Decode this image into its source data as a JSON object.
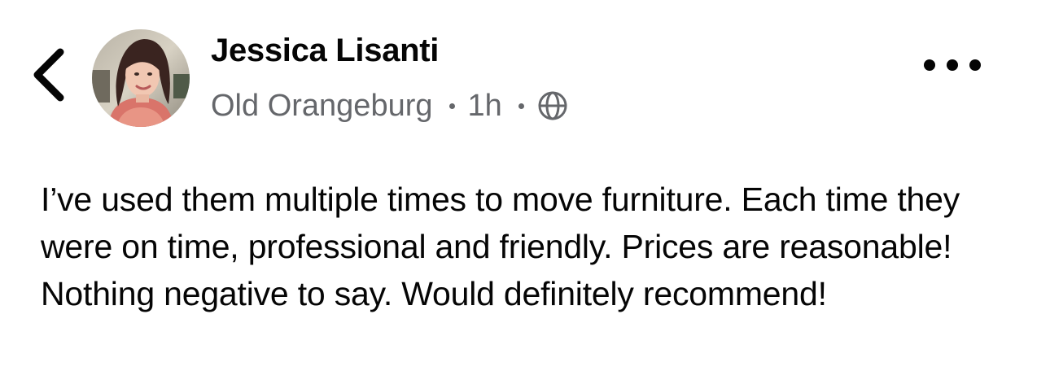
{
  "header": {
    "back_icon": "chevron-left-icon",
    "author_name": "Jessica Lisanti",
    "location": "Old Orangeburg",
    "time": "1h",
    "privacy_icon": "globe-icon",
    "more_icon": "more-horizontal-icon"
  },
  "post": {
    "text": "I’ve used them multiple times to move furniture. Each time they were on time, professional and friendly. Prices are reasonable! Nothing negative to say. Would definitely recommend!"
  },
  "colors": {
    "text_primary": "#050505",
    "text_secondary": "#65676b",
    "background": "#ffffff"
  }
}
